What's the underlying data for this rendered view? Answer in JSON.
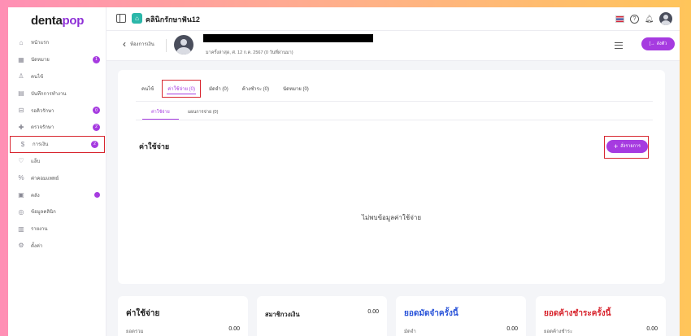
{
  "app": {
    "logo_main": "denta",
    "logo_accent": "pop"
  },
  "topbar": {
    "clinic_name": "คลินิกรักษาฟัน12"
  },
  "sidebar": {
    "items": [
      {
        "label": "หน้าแรก",
        "icon": "home-icon",
        "glyph": "⌂"
      },
      {
        "label": "นัดหมาย",
        "icon": "calendar-icon",
        "glyph": "▦",
        "badge": "1"
      },
      {
        "label": "คนไข้",
        "icon": "person-icon",
        "glyph": "♙"
      },
      {
        "label": "บันทึกการทำงาน",
        "icon": "notes-icon",
        "glyph": "▤"
      },
      {
        "label": "รอคิวรักษา",
        "icon": "chair-icon",
        "glyph": "⊟",
        "badge": "0"
      },
      {
        "label": "ตรวจรักษา",
        "icon": "clinic-icon",
        "glyph": "✚",
        "badge": "2"
      },
      {
        "label": "การเงิน",
        "icon": "money-icon",
        "glyph": "$",
        "badge": "2",
        "active": true
      },
      {
        "label": "แล็บ",
        "icon": "tooth-icon",
        "glyph": "♡"
      },
      {
        "label": "ค่าคอมแพทย์",
        "icon": "percent-icon",
        "glyph": "%"
      },
      {
        "label": "คลัง",
        "icon": "box-icon",
        "glyph": "▣",
        "dot": true
      },
      {
        "label": "ข้อมูลคลินิก",
        "icon": "info-icon",
        "glyph": "◎"
      },
      {
        "label": "รายงาน",
        "icon": "chart-icon",
        "glyph": "▥"
      },
      {
        "label": "ตั้งค่า",
        "icon": "gear-icon",
        "glyph": "⚙"
      }
    ]
  },
  "patient": {
    "back_label": "ห้องการเงิน",
    "subtitle": "มาครั้งล่าสุด, ศ. 12 ก.ค. 2567 (0 วันที่ผ่านมา)",
    "checkout_label": "ส่งตัว"
  },
  "tabs": [
    {
      "label": "คนไข้"
    },
    {
      "label": "ค่าใช้จ่าย (0)",
      "active": true
    },
    {
      "label": "มัดจำ (0)"
    },
    {
      "label": "ค้างชำระ (0)"
    },
    {
      "label": "นัดหมาย (0)"
    }
  ],
  "subtabs": [
    {
      "label": "ค่าใช้จ่าย",
      "active": true
    },
    {
      "label": "แผนการจ่าย (0)"
    }
  ],
  "section": {
    "title": "ค่าใช้จ่าย",
    "add_label": "สั่งรายการ",
    "empty_text": "ไม่พบข้อมูลค่าใช้จ่าย"
  },
  "summary_cards": [
    {
      "title": "ค่าใช้จ่าย",
      "value": "",
      "sub_label": "ยอดรวม",
      "sub_value": "0.00",
      "color": "#222222"
    },
    {
      "title": "สมาชิกวงเงิน",
      "value": "0.00",
      "sub_label": "",
      "sub_value": "",
      "color": "#222222"
    },
    {
      "title": "ยอดมัดจำครั้งนี้",
      "value": "",
      "sub_label": "มัดจำ",
      "sub_value": "0.00",
      "color": "#2b55d9"
    },
    {
      "title": "ยอดค้างชำระครั้งนี้",
      "value": "",
      "sub_label": "ยอดค้างชำระ",
      "sub_value": "0.00",
      "color": "#d8262f"
    }
  ]
}
